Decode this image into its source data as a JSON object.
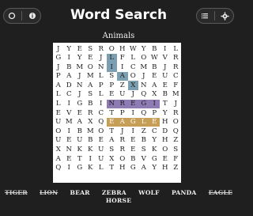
{
  "header": {
    "title": "Word Search",
    "subtitle": "Animals"
  },
  "grid": {
    "rows": [
      "JYESROHWYBIL",
      "GIYEJLFLOWVR",
      "JBMONIICMBJR",
      "PAJMLSAOJEUC",
      "ADNAPPZXNAEF",
      "LCJSLEUJQXBM",
      "LIGBINREGITJ",
      "EVERCTPIQPYR",
      "UMAXQEAGLEHO",
      "OIBMOTJIZCDQ",
      "UEUBEAREBYHZ",
      "XNKKUSRESKOS",
      "AETIUXOBVGEF",
      "QIGKLTHGAYHZ"
    ],
    "highlights": {
      "blue": [
        [
          1,
          5
        ],
        [
          2,
          5
        ],
        [
          3,
          6
        ],
        [
          4,
          7
        ]
      ],
      "purple": [
        [
          6,
          5
        ],
        [
          6,
          6
        ],
        [
          6,
          7
        ],
        [
          6,
          8
        ],
        [
          6,
          9
        ]
      ],
      "orange": [
        [
          8,
          5
        ],
        [
          8,
          6
        ],
        [
          8,
          7
        ],
        [
          8,
          8
        ],
        [
          8,
          9
        ]
      ]
    }
  },
  "word_list": [
    {
      "word": "TIGER",
      "found": true
    },
    {
      "word": "LION",
      "found": true
    },
    {
      "word": "BEAR",
      "found": false
    },
    {
      "word": "ZEBRA",
      "found": false
    },
    {
      "word": "WOLF",
      "found": false
    },
    {
      "word": "PANDA",
      "found": false
    },
    {
      "word": "EAGLE",
      "found": true
    },
    {
      "word": "HORSE",
      "found": false
    }
  ],
  "colors": {
    "background": "#1f1f1f",
    "board": "#ffffff",
    "highlight_blue": "#7b9fb1",
    "highlight_purple": "#8f7bb4",
    "highlight_orange": "#c79e55"
  },
  "icons": {
    "left": [
      "circle-icon",
      "info-icon"
    ],
    "right": [
      "list-icon",
      "settings-icon"
    ]
  }
}
